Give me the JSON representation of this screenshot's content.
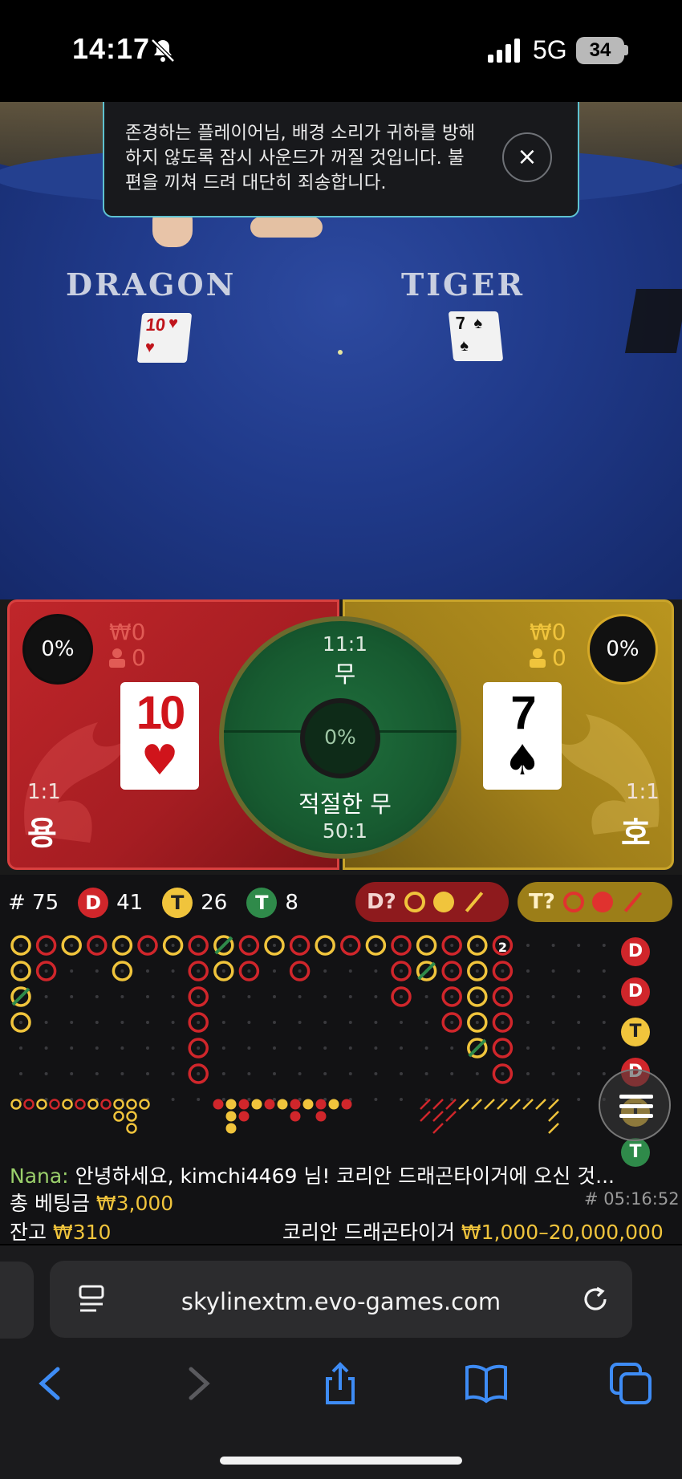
{
  "status_bar": {
    "time": "14:17",
    "network": "5G",
    "battery": "34"
  },
  "notification": {
    "text": "존경하는 플레이어님, 배경 소리가 귀하를 방해하지 않도록 잠시 사운드가 꺼질 것입니다. 불편을 끼쳐 드려 대단히 죄송합니다.",
    "close": "×"
  },
  "video": {
    "dragon_label": "DRAGON",
    "tiger_label": "TIGER",
    "dragon_card_small": "10",
    "tiger_card_small": "7"
  },
  "dragon": {
    "percent": "0%",
    "bet_amount": "₩0",
    "players": "0",
    "card_rank": "10",
    "card_suit": "♥",
    "payout": "1:1",
    "name": "용",
    "color": "#c0262a"
  },
  "tiger": {
    "percent": "0%",
    "bet_amount": "₩0",
    "players": "0",
    "card_rank": "7",
    "card_suit": "♠",
    "payout": "1:1",
    "name": "호",
    "color": "#b9951f"
  },
  "tie": {
    "top_ratio": "11:1",
    "top_label": "무",
    "percent": "0%",
    "bottom_label": "적절한 무",
    "bottom_ratio": "50:1",
    "color": "#1f6e3c"
  },
  "roadmap": {
    "round_label": "# 75",
    "dragon_badge": "D",
    "dragon_count": "41",
    "tiger_badge": "T",
    "tiger_count": "26",
    "tie_badge": "T",
    "tie_count": "8",
    "predict_dragon": "D?",
    "predict_tiger": "T?",
    "bead_column": [
      "D",
      "D",
      "T",
      "D",
      "T",
      "T"
    ],
    "tie_marker_text": "2"
  },
  "chat": {
    "nickname": "Nana:",
    "message": "안녕하세요, kimchi4469 님! 코리안 드래곤타이거에 오신 것..."
  },
  "totals": {
    "total_bet_label": "총 베팅금",
    "total_bet_value": "₩3,000",
    "balance_label": "잔고",
    "balance_value": "₩310",
    "round_id": "# 05:16:52",
    "table_name": "코리안 드래곤타이거",
    "limits": "₩1,000–20,000,000"
  },
  "browser": {
    "url": "skylinextm.evo-games.com"
  },
  "colors": {
    "dragon_red": "#d0262b",
    "tiger_gold": "#f0c43c",
    "tie_green": "#2f8a4a"
  }
}
